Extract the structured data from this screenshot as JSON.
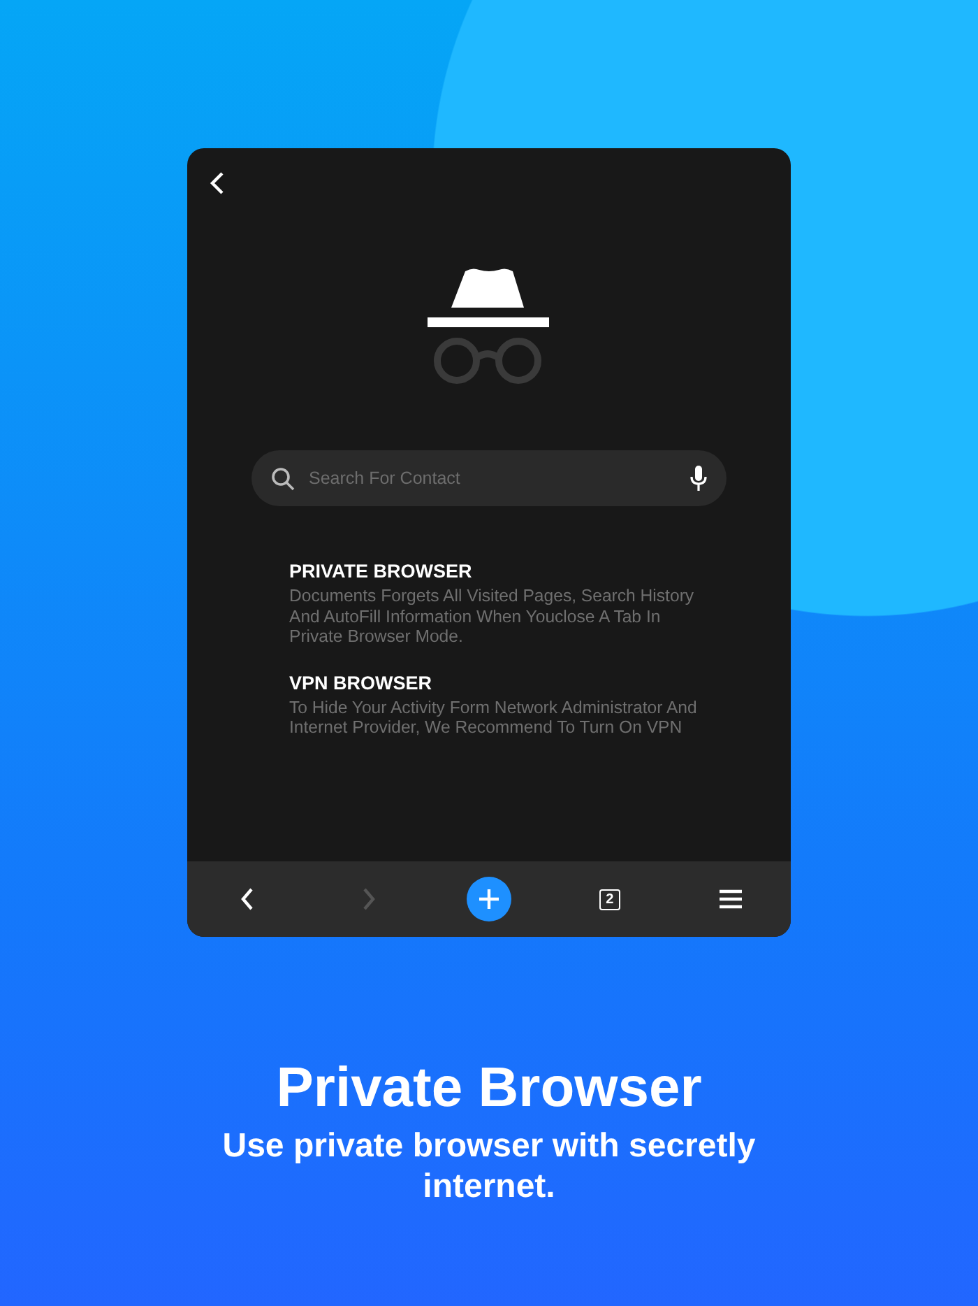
{
  "device": {
    "search": {
      "placeholder": "Search For Contact"
    },
    "sections": [
      {
        "title": "PRIVATE BROWSER",
        "text": "Documents Forgets All Visited Pages, Search History And AutoFill Information When Youclose A Tab In Private Browser Mode."
      },
      {
        "title": "VPN BROWSER",
        "text": "To Hide Your Activity Form Network Administrator And Internet Provider, We Recommend To Turn On VPN"
      }
    ],
    "bottom_bar": [
      {
        "kind": "back",
        "disabled": false
      },
      {
        "kind": "forward",
        "disabled": true
      },
      {
        "kind": "add",
        "disabled": false
      },
      {
        "kind": "tabs",
        "count": "2",
        "disabled": false
      },
      {
        "kind": "menu",
        "disabled": false
      }
    ]
  },
  "headline": "Private Browser",
  "subtitle": "Use private browser with secretly internet."
}
